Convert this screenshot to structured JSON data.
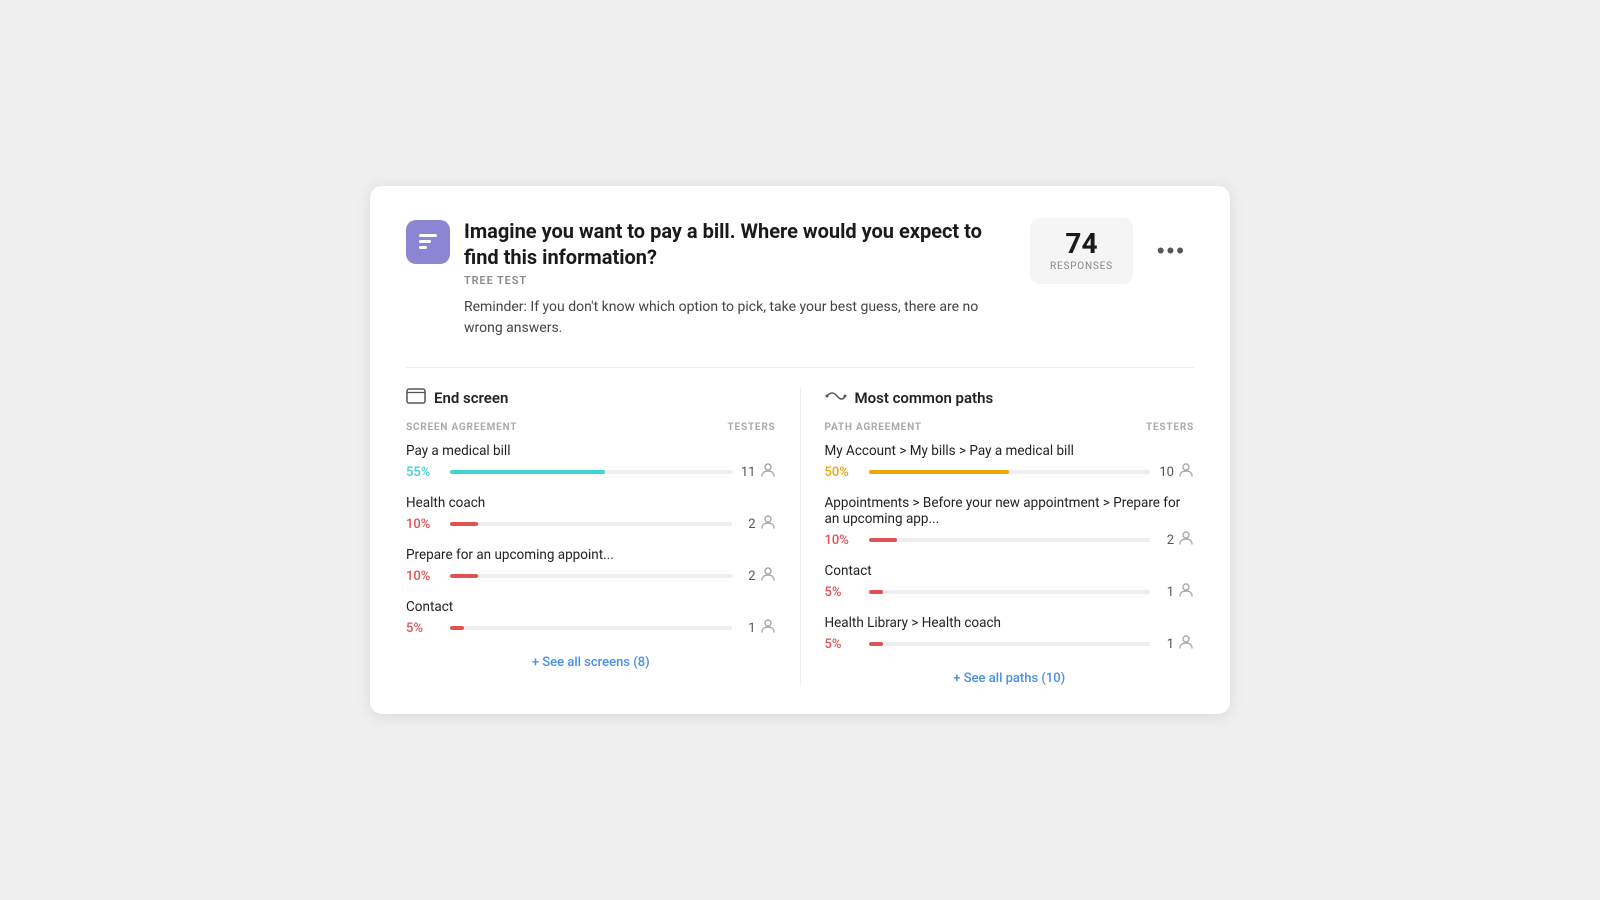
{
  "card": {
    "icon_label": "tree-test-icon",
    "title": "Imagine you want to pay a bill. Where would you expect to find this information?",
    "badge": "TREE TEST",
    "reminder": "Reminder: If you don't know which option to pick, take your best guess, there are no wrong answers.",
    "responses_count": "74",
    "responses_label": "RESPONSES",
    "more_button": "•••"
  },
  "end_screen": {
    "section_title": "End screen",
    "col_agreement": "SCREEN AGREEMENT",
    "col_testers": "TESTERS",
    "rows": [
      {
        "label": "Pay a medical bill",
        "pct": "55%",
        "pct_color": "cyan",
        "bar_pct": 55,
        "testers": 11
      },
      {
        "label": "Health coach",
        "pct": "10%",
        "pct_color": "red",
        "bar_pct": 10,
        "testers": 2
      },
      {
        "label": "Prepare for an upcoming appoint...",
        "pct": "10%",
        "pct_color": "red",
        "bar_pct": 10,
        "testers": 2
      },
      {
        "label": "Contact",
        "pct": "5%",
        "pct_color": "red",
        "bar_pct": 5,
        "testers": 1
      }
    ],
    "see_all": "+ See all screens (8)"
  },
  "most_common_paths": {
    "section_title": "Most common paths",
    "col_agreement": "PATH AGREEMENT",
    "col_testers": "TESTERS",
    "rows": [
      {
        "label": "My Account > My bills > Pay a medical bill",
        "pct": "50%",
        "pct_color": "orange",
        "bar_pct": 50,
        "testers": 10
      },
      {
        "label": "Appointments > Before your new appointment > Prepare for an upcoming app...",
        "pct": "10%",
        "pct_color": "red",
        "bar_pct": 10,
        "testers": 2
      },
      {
        "label": "Contact",
        "pct": "5%",
        "pct_color": "red",
        "bar_pct": 5,
        "testers": 1
      },
      {
        "label": "Health Library > Health coach",
        "pct": "5%",
        "pct_color": "red",
        "bar_pct": 5,
        "testers": 1
      }
    ],
    "see_all": "+ See all paths (10)"
  },
  "colors": {
    "cyan": "#3dd6d0",
    "red": "#e05252",
    "orange": "#f0a500"
  }
}
